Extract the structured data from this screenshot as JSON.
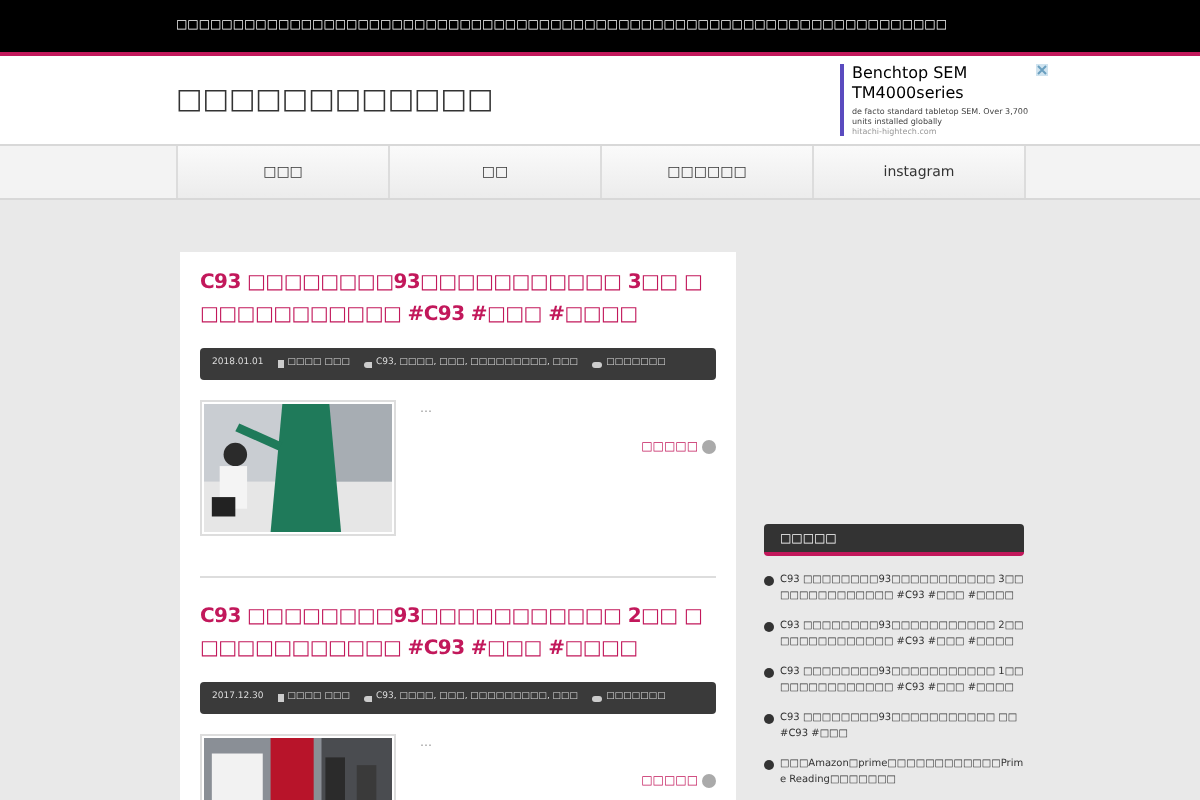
{
  "top_bar": {
    "text": "□□□□□□□□□□□□□□□□□□□□□□□□□□□□□□□□□□□□□□□□□□□□□□□□□□□□□□□□□□□□□□□□□□□□"
  },
  "header": {
    "site_title": "□□□□□□□□□□□□",
    "ad": {
      "title": "Benchtop SEM TM4000series",
      "body": "de facto standard tabletop SEM. Over 3,700 units installed globally",
      "link": "hitachi-hightech.com"
    }
  },
  "nav": [
    {
      "label": "□□□"
    },
    {
      "label": "□□"
    },
    {
      "label": "□□□□□□"
    },
    {
      "label": "instagram"
    }
  ],
  "posts": [
    {
      "title": "C93 □□□□□□□□93□□□□□□□□□□□ 3□□ □□□□□□□□□□□□ #C93 #□□□ #□□□□",
      "date": "2018.01.01",
      "category": "□□□□ □□□",
      "tags": "C93, □□□□, □□□, □□□□□□□□□, □□□",
      "comments": "□□□□□□□",
      "excerpt": "…",
      "more": "□□□□□"
    },
    {
      "title": "C93 □□□□□□□□93□□□□□□□□□□□ 2□□ □□□□□□□□□□□□ #C93 #□□□ #□□□□",
      "date": "2017.12.30",
      "category": "□□□□ □□□",
      "tags": "C93, □□□□, □□□, □□□□□□□□□, □□□",
      "comments": "□□□□□□□",
      "excerpt": "…",
      "more": "□□□□□"
    }
  ],
  "sidebar": {
    "heading": "□□□□□",
    "items": [
      {
        "text": "C93 □□□□□□□□93□□□□□□□□□□□ 3□□ □□□□□□□□□□□□ #C93 #□□□ #□□□□"
      },
      {
        "text": "C93 □□□□□□□□93□□□□□□□□□□□ 2□□ □□□□□□□□□□□□ #C93 #□□□ #□□□□"
      },
      {
        "text": "C93 □□□□□□□□93□□□□□□□□□□□ 1□□ □□□□□□□□□□□□ #C93 #□□□ #□□□□"
      },
      {
        "text": "C93 □□□□□□□□93□□□□□□□□□□□ □□ #C93 #□□□"
      },
      {
        "text": "□□□Amazon□prime□□□□□□□□□□□□Prime Reading□□□□□□□"
      }
    ]
  }
}
